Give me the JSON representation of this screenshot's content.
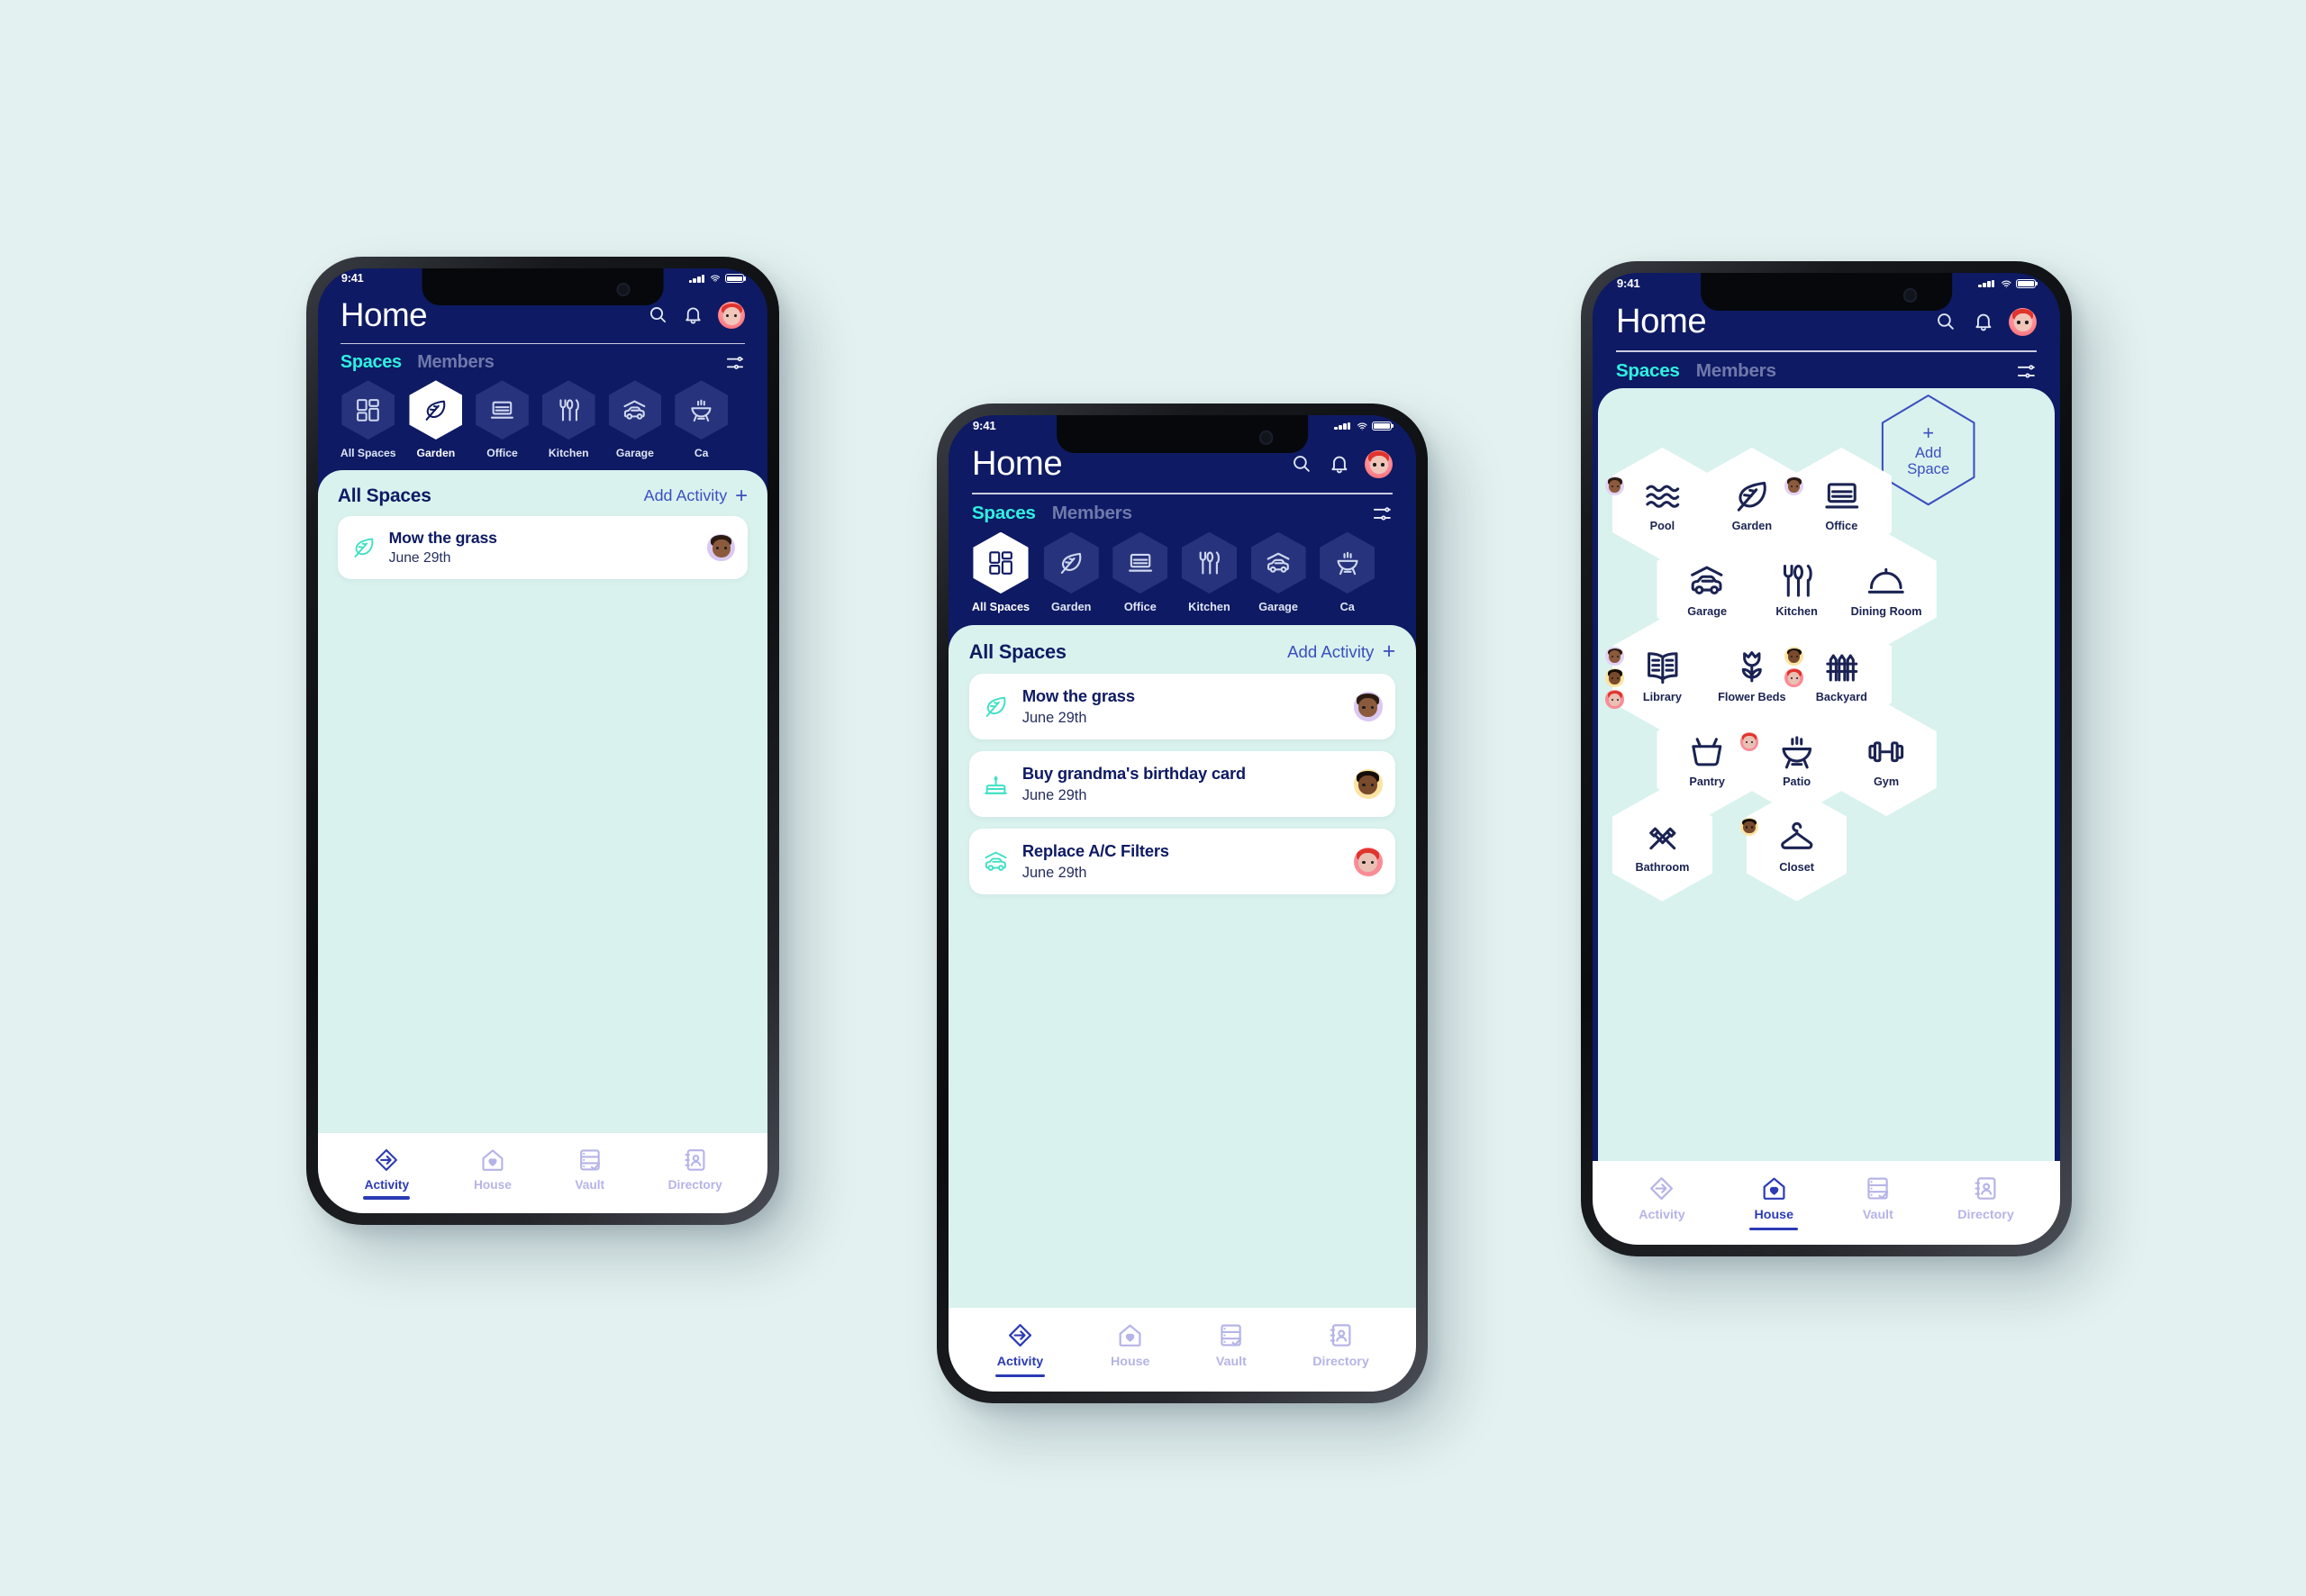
{
  "canvas": {
    "background": "#e3f1f0"
  },
  "theme": {
    "navy": "#0e1a63",
    "mint_panel": "#d9f2ee",
    "accent_cyan": "#2ff0e0",
    "accent_indigo": "#3b4fbf",
    "icon_teal": "#3fe0c5",
    "chip_idle": "#27337c",
    "nav_idle": "#b5b4e8"
  },
  "status_bar": {
    "time": "9:41",
    "signal_icon": "cellular-bars-icon",
    "wifi_icon": "wifi-icon",
    "battery_icon": "battery-full-icon"
  },
  "header": {
    "title": "Home",
    "search_icon": "search-icon",
    "bell_icon": "notification-bell-icon",
    "avatar_icon": "user-avatar",
    "tabs": [
      {
        "label": "Spaces",
        "active": true
      },
      {
        "label": "Members",
        "active": false
      }
    ],
    "filter_icon": "filter-sliders-icon"
  },
  "space_chips": [
    {
      "label": "All Spaces",
      "icon": "grid-squares-icon"
    },
    {
      "label": "Garden",
      "icon": "leaf-icon"
    },
    {
      "label": "Office",
      "icon": "laptop-icon"
    },
    {
      "label": "Kitchen",
      "icon": "cutlery-icon"
    },
    {
      "label": "Garage",
      "icon": "car-carport-icon"
    },
    {
      "label": "Ca",
      "icon": "grill-icon"
    }
  ],
  "panel": {
    "title": "All Spaces",
    "add_activity_label": "Add Activity",
    "add_plus": "+"
  },
  "activities": [
    {
      "title": "Mow the grass",
      "date": "June 29th",
      "icon": "leaf-icon",
      "avatar_icon": "avatar-purple",
      "avatar_bg": "#d9c8f2",
      "skin": "#8b5a3c",
      "hair": "#2b1a10"
    },
    {
      "title": "Buy grandma's birthday card",
      "date": "June 29th",
      "icon": "birthday-cake-icon",
      "avatar_icon": "avatar-yellow",
      "avatar_bg": "#fbe3a1",
      "skin": "#7a4a2c",
      "hair": "#140d08"
    },
    {
      "title": "Replace A/C Filters",
      "date": "June 29th",
      "icon": "car-carport-icon",
      "avatar_icon": "avatar-red",
      "avatar_bg": "#f98c96",
      "skin": "#e8c0b4",
      "hair": "#e0342c"
    }
  ],
  "hex_grid": {
    "add_space": {
      "plus": "+",
      "line1": "Add",
      "line2": "Space",
      "icon": "plus-icon"
    },
    "spaces": [
      {
        "label": "Pool",
        "icon": "waves-icon",
        "badges": [
          {
            "bg": "#e2d2f5",
            "skin": "#8b5a3c",
            "hair": "#2b1a10"
          }
        ]
      },
      {
        "label": "Garden",
        "icon": "leaf-icon",
        "badges": []
      },
      {
        "label": "Office",
        "icon": "laptop-icon",
        "badges": [
          {
            "bg": "#e2d2f5",
            "skin": "#8b5a3c",
            "hair": "#2b1a10"
          }
        ]
      },
      {
        "label": "Garage",
        "icon": "car-carport-icon",
        "badges": []
      },
      {
        "label": "Kitchen",
        "icon": "cutlery-icon",
        "badges": []
      },
      {
        "label": "Dining Room",
        "icon": "cloche-icon",
        "badges": []
      },
      {
        "label": "Library",
        "icon": "open-book-icon",
        "badges": [
          {
            "bg": "#e2d2f5",
            "skin": "#8b5a3c",
            "hair": "#2b1a10"
          },
          {
            "bg": "#fbe3a1",
            "skin": "#7a4a2c",
            "hair": "#140d08"
          },
          {
            "bg": "#f98c96",
            "skin": "#e8c0b4",
            "hair": "#e0342c"
          }
        ]
      },
      {
        "label": "Flower Beds",
        "icon": "tulip-icon",
        "badges": []
      },
      {
        "label": "Backyard",
        "icon": "fence-icon",
        "badges": [
          {
            "bg": "#fbe3a1",
            "skin": "#7a4a2c",
            "hair": "#140d08"
          },
          {
            "bg": "#f98c96",
            "skin": "#e8c0b4",
            "hair": "#e0342c"
          }
        ]
      },
      {
        "label": "Pantry",
        "icon": "basket-icon",
        "badges": []
      },
      {
        "label": "Patio",
        "icon": "grill-icon",
        "badges": [
          {
            "bg": "#f98c96",
            "skin": "#e8c0b4",
            "hair": "#e0342c"
          }
        ]
      },
      {
        "label": "Gym",
        "icon": "dumbbell-icon",
        "badges": []
      },
      {
        "label": "Bathroom",
        "icon": "toothbrush-icon",
        "badges": []
      },
      {
        "label": "Closet",
        "icon": "hanger-icon",
        "badges": [
          {
            "bg": "#fbe3a1",
            "skin": "#7a4a2c",
            "hair": "#140d08"
          }
        ]
      }
    ]
  },
  "bottom_nav": [
    {
      "label": "Activity",
      "icon": "activity-diamond-arrow-icon"
    },
    {
      "label": "House",
      "icon": "house-heart-icon"
    },
    {
      "label": "Vault",
      "icon": "vault-checklist-icon"
    },
    {
      "label": "Directory",
      "icon": "directory-contact-icon"
    }
  ],
  "screens": [
    {
      "name": "phone-1-garden-activity",
      "active_chip": "Garden",
      "active_nav": "Activity",
      "activity_count": 1
    },
    {
      "name": "phone-2-all-spaces-activity",
      "active_chip": "All Spaces",
      "active_nav": "Activity",
      "activity_count": 3
    },
    {
      "name": "phone-3-house-hexgrid",
      "active_chip": null,
      "active_nav": "House",
      "activity_count": 0
    }
  ]
}
